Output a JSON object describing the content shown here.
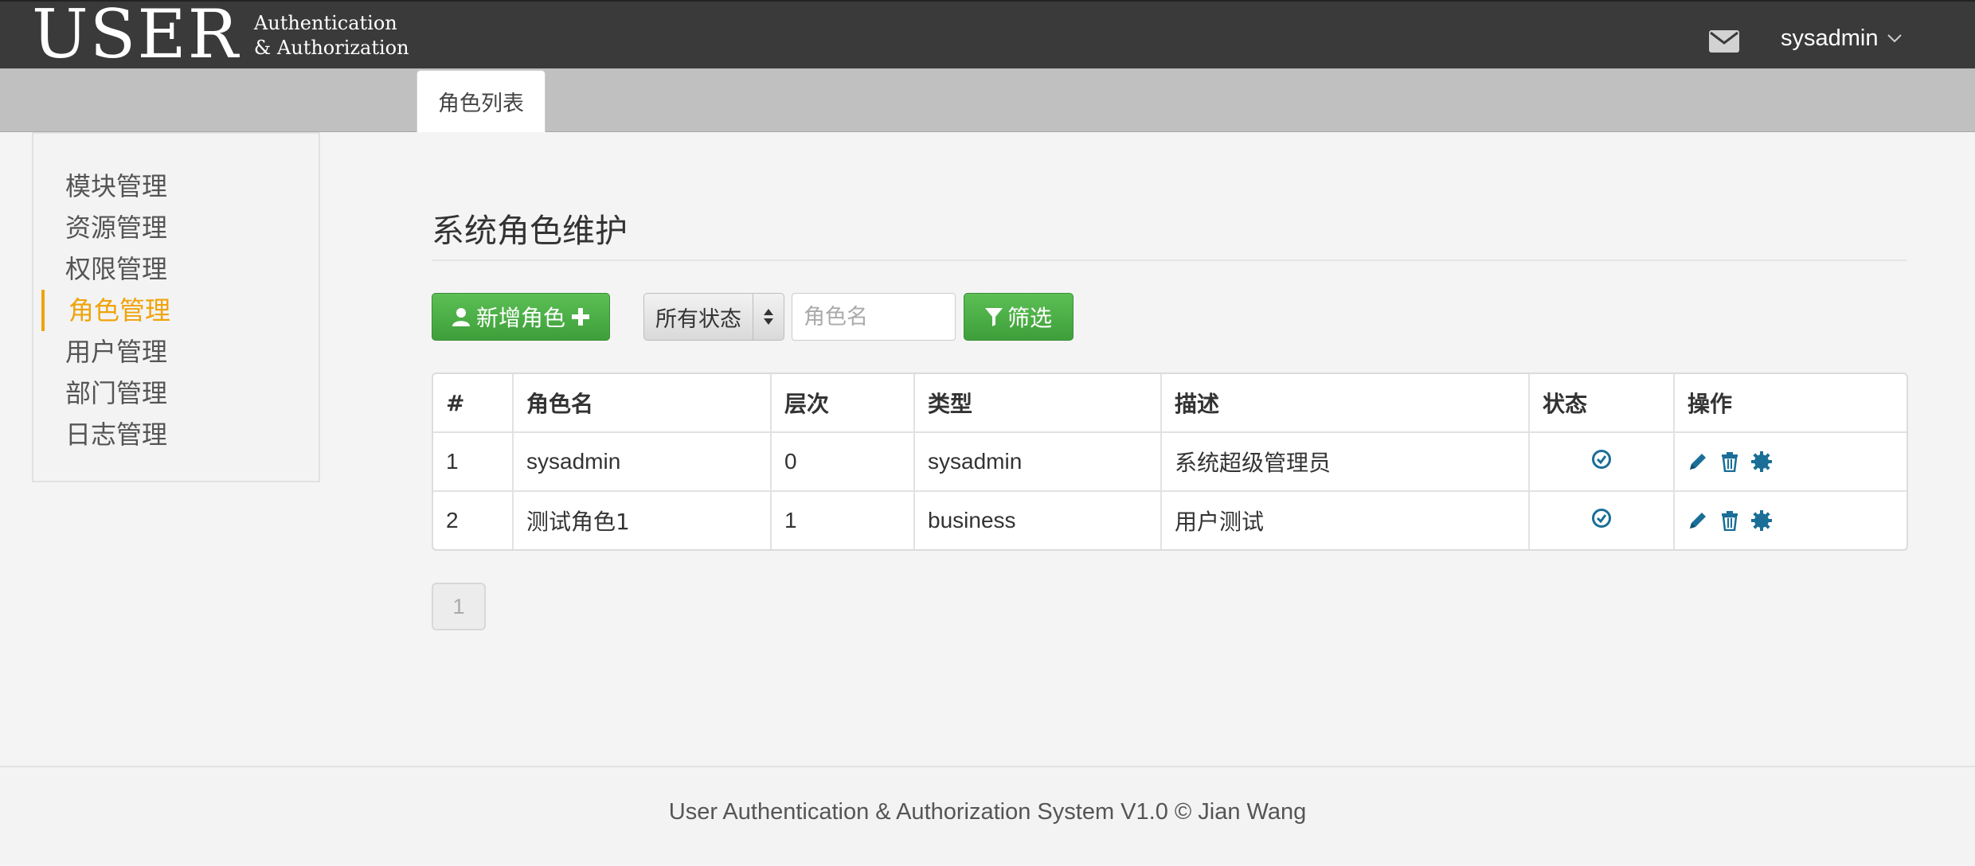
{
  "navbar": {
    "brand_big": "USER",
    "brand_line1": "Authentication",
    "brand_line2": "& Authorization",
    "mail_icon": "envelope-icon",
    "username": "sysadmin",
    "caret_icon": "chevron-down-icon"
  },
  "tabs": [
    {
      "label": "角色列表",
      "active": true
    }
  ],
  "sidebar": {
    "items": [
      {
        "label": "模块管理",
        "active": false
      },
      {
        "label": "资源管理",
        "active": false
      },
      {
        "label": "权限管理",
        "active": false
      },
      {
        "label": "角色管理",
        "active": true
      },
      {
        "label": "用户管理",
        "active": false
      },
      {
        "label": "部门管理",
        "active": false
      },
      {
        "label": "日志管理",
        "active": false
      }
    ]
  },
  "main": {
    "title": "系统角色维护",
    "add_button_label": "新增角色",
    "status_select_value": "所有状态",
    "search_placeholder": "角色名",
    "filter_button_label": "筛选"
  },
  "table": {
    "columns": [
      "#",
      "角色名",
      "层次",
      "类型",
      "描述",
      "状态",
      "操作"
    ],
    "rows": [
      {
        "id": "1",
        "name": "sysadmin",
        "level": "0",
        "type": "sysadmin",
        "desc": "系统超级管理员",
        "status_icon": "check-circle-icon"
      },
      {
        "id": "2",
        "name": "测试角色1",
        "level": "1",
        "type": "business",
        "desc": "用户测试",
        "status_icon": "check-circle-icon"
      }
    ],
    "action_icons": [
      "pencil-icon",
      "trash-icon",
      "gear-icon"
    ]
  },
  "pagination": {
    "pages": [
      "1"
    ],
    "current": "1"
  },
  "footer": {
    "text": "User Authentication & Authorization System V1.0 © Jian Wang"
  },
  "colors": {
    "navbar_bg": "#3a3a3a",
    "accent_active": "#f0a30a",
    "button_green": "#4cae4c",
    "icon_blue": "#1a6e97"
  }
}
